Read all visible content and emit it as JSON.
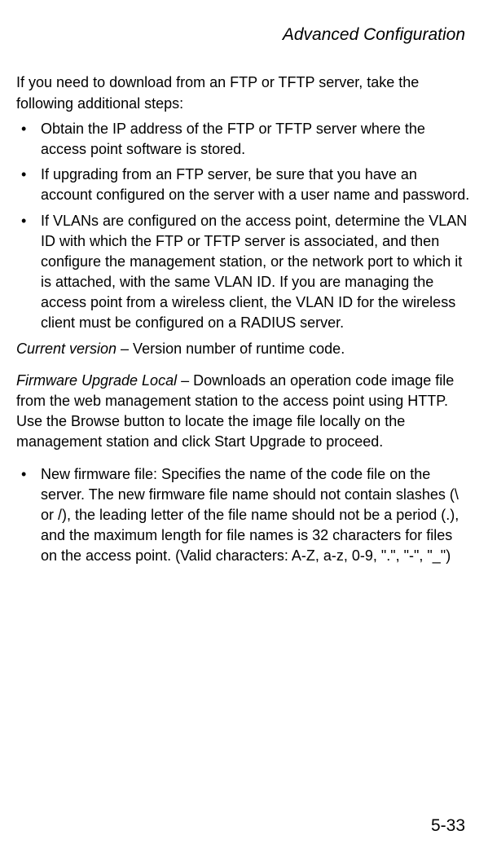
{
  "header": {
    "title": "Advanced Configuration"
  },
  "intro": "If you need to download from an FTP or TFTP server, take the following additional steps:",
  "bullets1": [
    "Obtain the IP address of the FTP or TFTP server where the access point software is stored.",
    "If upgrading from an FTP server, be sure that you have an account configured on the server with a user name and password.",
    "If VLANs are configured on the access point, determine the VLAN ID with which the FTP or TFTP server is associated, and then configure the management station, or the network port to which it is attached, with the same VLAN ID. If you are managing the access point from a wireless client, the VLAN ID for the wireless client must be configured on a RADIUS server."
  ],
  "currentVersion": {
    "lead": "Current version",
    "rest": " – Version number of runtime code."
  },
  "firmwareUpgrade": {
    "lead": "Firmware Upgrade Local",
    "rest": " – Downloads an operation code image file from the web management station to the access point using HTTP. Use the Browse button to locate the image file locally on the management station and click Start Upgrade to proceed."
  },
  "bullets2": [
    "New firmware file: Specifies the name of the code file on the server. The new firmware file name should not contain slashes (\\ or /), the leading letter of the file name should not be a period (.), and the maximum length for file names is 32 characters for files on the access point. (Valid characters: A-Z, a-z, 0-9, \".\", \"-\", \"_\")"
  ],
  "bulletChar": "•",
  "pageNumber": "5-33"
}
